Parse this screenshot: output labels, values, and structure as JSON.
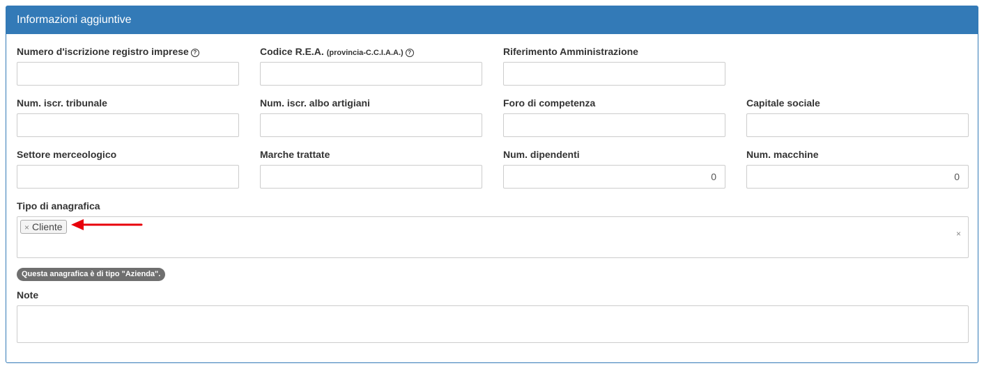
{
  "panel": {
    "title": "Informazioni aggiuntive"
  },
  "fields": {
    "numero_registro": {
      "label": "Numero d'iscrizione registro imprese",
      "value": ""
    },
    "codice_rea": {
      "label": "Codice R.E.A.",
      "label_small": "(provincia-C.C.I.A.A.)",
      "value": ""
    },
    "riferimento": {
      "label": "Riferimento Amministrazione",
      "value": ""
    },
    "tribunale": {
      "label": "Num. iscr. tribunale",
      "value": ""
    },
    "albo": {
      "label": "Num. iscr. albo artigiani",
      "value": ""
    },
    "foro": {
      "label": "Foro di competenza",
      "value": ""
    },
    "capitale": {
      "label": "Capitale sociale",
      "value": ""
    },
    "settore": {
      "label": "Settore merceologico",
      "value": ""
    },
    "marche": {
      "label": "Marche trattate",
      "value": ""
    },
    "dipendenti": {
      "label": "Num. dipendenti",
      "value": "0"
    },
    "macchine": {
      "label": "Num. macchine",
      "value": "0"
    },
    "tipo": {
      "label": "Tipo di anagrafica",
      "tags": [
        "Cliente"
      ],
      "remove_glyph": "×",
      "clear_glyph": "×"
    },
    "note": {
      "label": "Note",
      "value": ""
    }
  },
  "help_glyph": "?",
  "badge": "Questa anagrafica è di tipo \"Azienda\".",
  "annotation": {
    "arrow_color": "#e8000b"
  },
  "colors": {
    "panel": "#337ab7",
    "border": "#cccccc",
    "badge": "#6f6f6f"
  }
}
